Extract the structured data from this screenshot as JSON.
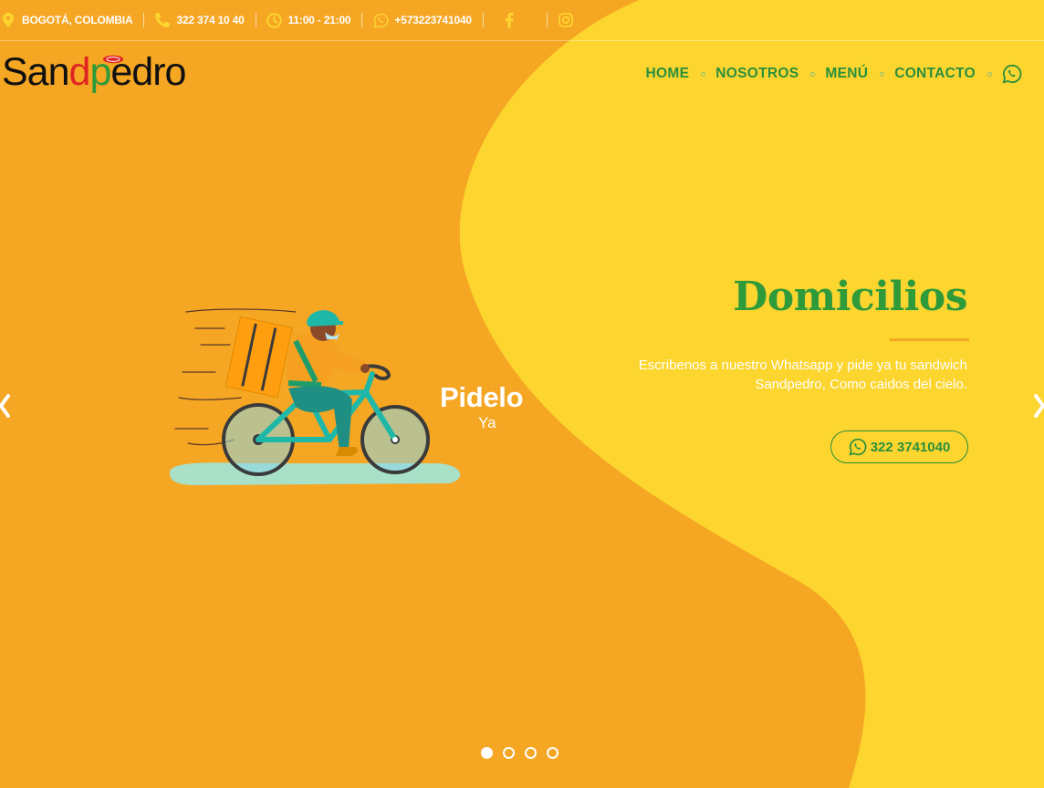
{
  "topbar": {
    "location": "BOGOTÁ, COLOMBIA",
    "phone": "322 374 10 40",
    "hours": "11:00 - 21:00",
    "whatsapp": "+573223741040"
  },
  "logo": {
    "part1": "San",
    "part2": "d",
    "part3": "p",
    "part4": "edro"
  },
  "nav": [
    "HOME",
    "NOSOTROS",
    "MENÚ",
    "CONTACTO"
  ],
  "hero": {
    "title": "Domicilios",
    "text": "Escribenos a nuestro Whatsapp y pide ya tu sandwich Sandpedro, Como caidos del cielo.",
    "button": "322 3741040",
    "illustration_title": "Pidelo",
    "illustration_subtitle": "Ya"
  },
  "slider": {
    "slides": 4,
    "active": 1
  },
  "colors": {
    "orange": "#f5a623",
    "yellow": "#fdd52f",
    "green": "#2e9a3a"
  }
}
